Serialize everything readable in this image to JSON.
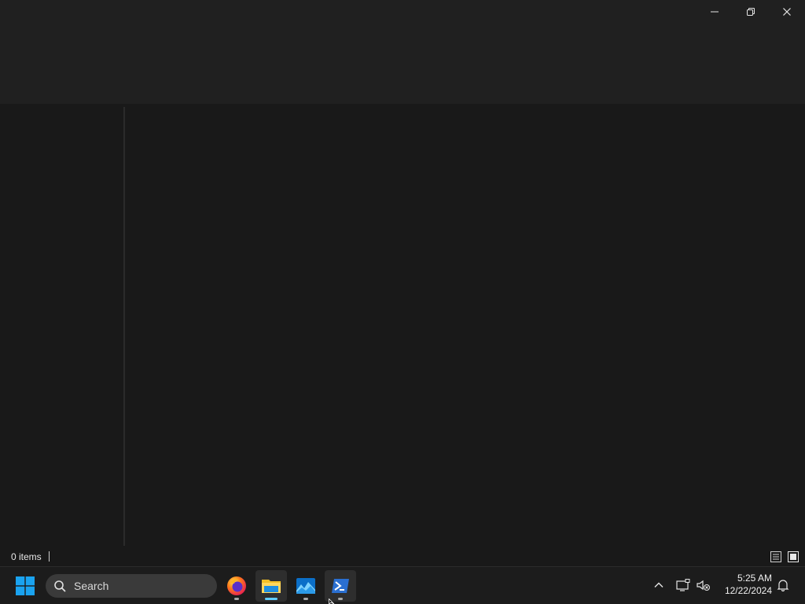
{
  "window": {
    "controls": {
      "minimize_icon": "minimize-icon",
      "restore_icon": "restore-icon",
      "close_icon": "close-icon"
    }
  },
  "statusbar": {
    "item_count": "0 items",
    "view_buttons": [
      "details-view-icon",
      "large-icons-view-icon"
    ]
  },
  "taskbar": {
    "search_placeholder": "Search",
    "apps": [
      {
        "name": "firefox",
        "icon": "firefox-icon",
        "running": true,
        "active": false
      },
      {
        "name": "file-explorer",
        "icon": "folder-icon",
        "running": true,
        "active": true
      },
      {
        "name": "photos",
        "icon": "photos-icon",
        "running": true,
        "active": false
      },
      {
        "name": "powershell",
        "icon": "powershell-icon",
        "running": true,
        "active": false
      }
    ],
    "tray": [
      "chevron-up-icon",
      "network-icon",
      "volume-muted-icon"
    ],
    "time": "5:25 AM",
    "date": "12/22/2024",
    "notification_icon": "bell-icon"
  },
  "colors": {
    "background": "#191919",
    "titlebar": "#202020",
    "taskbar": "#1c1c1c",
    "accent": "#60cdff",
    "windows_logo": "#0ea5e9"
  }
}
